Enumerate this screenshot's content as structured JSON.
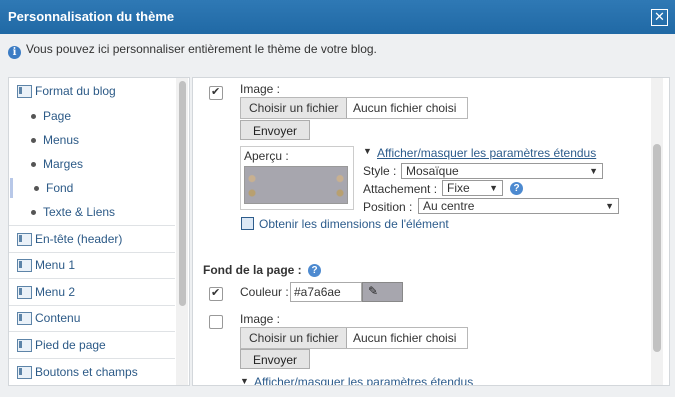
{
  "window": {
    "title": "Personnalisation du thème",
    "close_label": "✕"
  },
  "info": {
    "icon": "info-icon",
    "text": "Vous pouvez ici personnaliser entièrement le thème de votre blog."
  },
  "sidebar": {
    "format": "Format du blog",
    "sub": [
      "Page",
      "Menus",
      "Marges",
      "Fond",
      "Texte & Liens"
    ],
    "sections": [
      "En-tête (header)",
      "Menu 1",
      "Menu 2",
      "Contenu",
      "Pied de page",
      "Boutons et champs"
    ]
  },
  "section1": {
    "image_label": "Image :",
    "choose_file": "Choisir un fichier",
    "no_file": "Aucun fichier choisi",
    "send": "Envoyer",
    "preview_label": "Aperçu :",
    "toggle_link": "Afficher/masquer les paramètres étendus",
    "style_label": "Style :",
    "style_value": "Mosaïque",
    "attachment_label": "Attachement :",
    "attachment_value": "Fixe",
    "position_label": "Position :",
    "position_value": "Au centre",
    "dims_link": "Obtenir les dimensions de l'élément"
  },
  "section2": {
    "heading": "Fond de la page :",
    "color_label": "Couleur :",
    "color_value": "#a7a6ae",
    "image_label": "Image :",
    "choose_file": "Choisir un fichier",
    "no_file": "Aucun fichier choisi",
    "send": "Envoyer",
    "toggle_link": "Afficher/masquer les paramètres étendus"
  },
  "colors": {
    "title_bar": "#2a72ae",
    "swatch": "#a7a6ae",
    "link": "#2d5c8c"
  }
}
